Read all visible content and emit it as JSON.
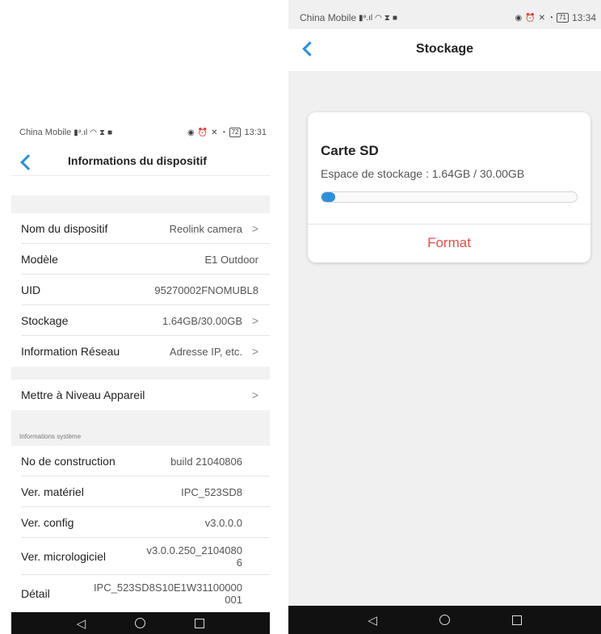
{
  "left": {
    "status": {
      "carrier": "China Mobile",
      "battery": "72",
      "time": "13:31"
    },
    "header": {
      "title": "Informations du dispositif"
    },
    "rows": [
      {
        "label": "Nom du dispositif",
        "value": "Reolink camera"
      },
      {
        "label": "Modèle",
        "value": "E1 Outdoor"
      },
      {
        "label": "UID",
        "value": "95270002FNOMUBL8"
      },
      {
        "label": "Stockage",
        "value": "1.64GB/30.00GB"
      },
      {
        "label": "Information Réseau",
        "value": "Adresse IP, etc."
      },
      {
        "label": "Mettre à Niveau Appareil",
        "value": ""
      }
    ],
    "system_section": {
      "label": "Informations système"
    },
    "system_rows": [
      {
        "label": "No de construction",
        "value": "build 21040806"
      },
      {
        "label": "Ver. matériel",
        "value": "IPC_523SD8"
      },
      {
        "label": "Ver. config",
        "value": "v3.0.0.0"
      },
      {
        "label": "Ver. micrologiciel",
        "value_line1": "v3.0.0.250_2104080",
        "value_line2": "6"
      },
      {
        "label": "Détail",
        "value_line1": "IPC_523SD8S10E1W31100000",
        "value_line2": "001"
      }
    ]
  },
  "right": {
    "status": {
      "carrier": "China Mobile",
      "battery": "71",
      "time": "13:34"
    },
    "header": {
      "title": "Stockage"
    },
    "card": {
      "title": "Carte SD",
      "subtitle": "Espace de stockage : 1.64GB / 30.00GB",
      "used_fraction": 0.055,
      "format_label": "Format"
    }
  },
  "colors": {
    "accent": "#2d8fd6",
    "danger": "#e0514b"
  },
  "icons": [
    "back-arrow-icon",
    "chevron-right-icon",
    "nav-back-icon",
    "nav-home-icon",
    "nav-recents-icon"
  ]
}
